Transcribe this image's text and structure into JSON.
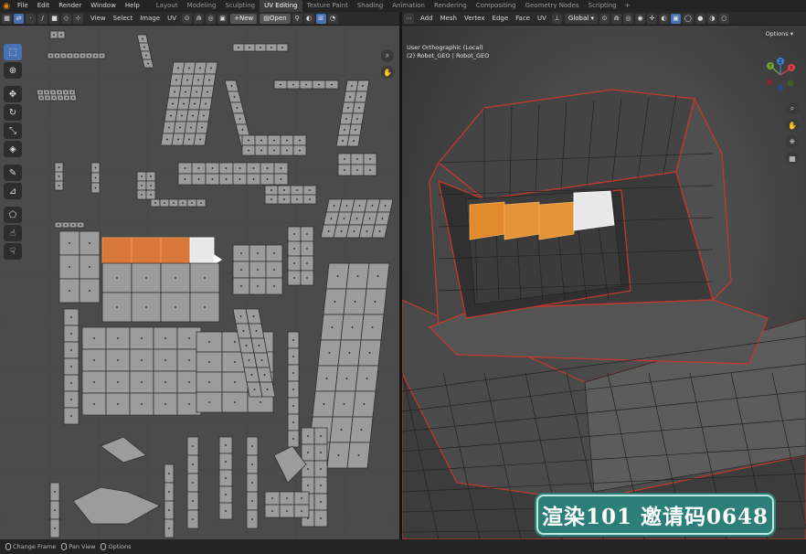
{
  "menu": [
    "File",
    "Edit",
    "Render",
    "Window",
    "Help"
  ],
  "workspaces": {
    "tabs": [
      "Layout",
      "Modeling",
      "Sculpting",
      "UV Editing",
      "Texture Paint",
      "Shading",
      "Animation",
      "Rendering",
      "Compositing",
      "Geometry Nodes",
      "Scripting"
    ],
    "active": "UV Editing",
    "add": "+"
  },
  "uv_header": {
    "menus": [
      "View",
      "Select",
      "Image",
      "UV"
    ],
    "new_label": "New",
    "open_label": "Open"
  },
  "viewport_header": {
    "menus": [
      "Add",
      "Mesh",
      "Vertex",
      "Edge",
      "Face",
      "UV"
    ],
    "orientation": "Global",
    "axes": [
      "X",
      "Y",
      "Z"
    ],
    "options_label": "Options"
  },
  "viewport_info": {
    "view_name": "User Orthographic (Local)",
    "object_line": "(2) Robot_GEO | Robot_GEO"
  },
  "gizmo": {
    "labels": [
      "X",
      "Y",
      "Z"
    ]
  },
  "watermark": "渲染101 邀请码0648",
  "status_bar": [
    "Change Frame",
    "Pan View",
    "Options"
  ],
  "colors": {
    "accent": "#4772b3",
    "selection_orange": "#e07a2e",
    "active_face": "#e8e8e8",
    "seam_red": "#d33a2c",
    "watermark_bg": "#2c7f78",
    "gizmo_x": "#e0414e",
    "gizmo_y": "#6da832",
    "gizmo_z": "#3b7fd6"
  },
  "icons": {
    "toolbar": [
      "select-box-icon",
      "cursor-icon",
      "move-icon",
      "rotate-icon",
      "scale-icon",
      "transform-icon",
      "annotate-icon",
      "rip-icon",
      "grab-icon",
      "relax-icon",
      "pinch-icon"
    ]
  }
}
